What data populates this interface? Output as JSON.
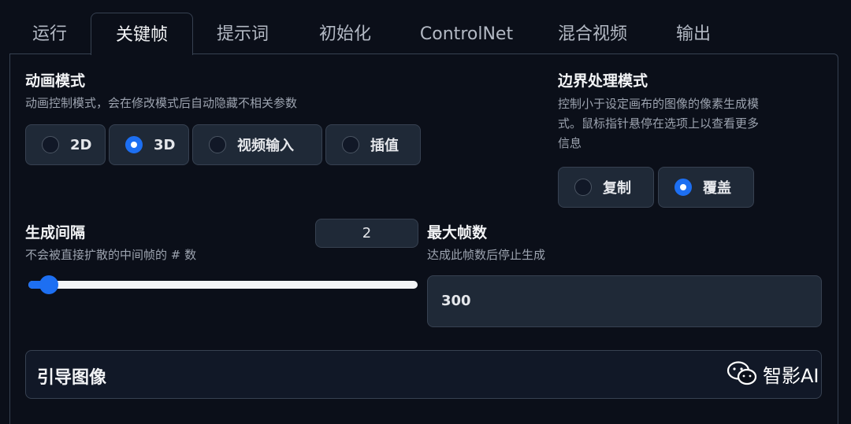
{
  "tabs": [
    "运行",
    "关键帧",
    "提示词",
    "初始化",
    "ControlNet",
    "混合视频",
    "输出"
  ],
  "active_tab": "关键帧",
  "animation_mode": {
    "title": "动画模式",
    "description": "动画控制模式，会在修改模式后自动隐藏不相关参数",
    "options": [
      "2D",
      "3D",
      "视频输入",
      "插值"
    ],
    "selected": "3D"
  },
  "border_mode": {
    "title": "边界处理模式",
    "description_line1": "控制小于设定画布的图像的像素生成模",
    "description_line2": "式。鼠标指针悬停在选项上以查看更多",
    "description_line3": "信息",
    "options": [
      "复制",
      "覆盖"
    ],
    "selected": "覆盖"
  },
  "cadence": {
    "title": "生成间隔",
    "description": "不会被直接扩散的中间帧的 # 数",
    "value": "2",
    "slider_fraction": 0.04
  },
  "max_frames": {
    "title": "最大帧数",
    "description": "达成此帧数后停止生成",
    "value": "300"
  },
  "guide_images": {
    "label": "引导图像"
  },
  "watermark": {
    "text": "智影AI",
    "icon": "wechat-icon"
  },
  "colors": {
    "accent": "#1d6ff2",
    "background": "#0b0f19"
  }
}
